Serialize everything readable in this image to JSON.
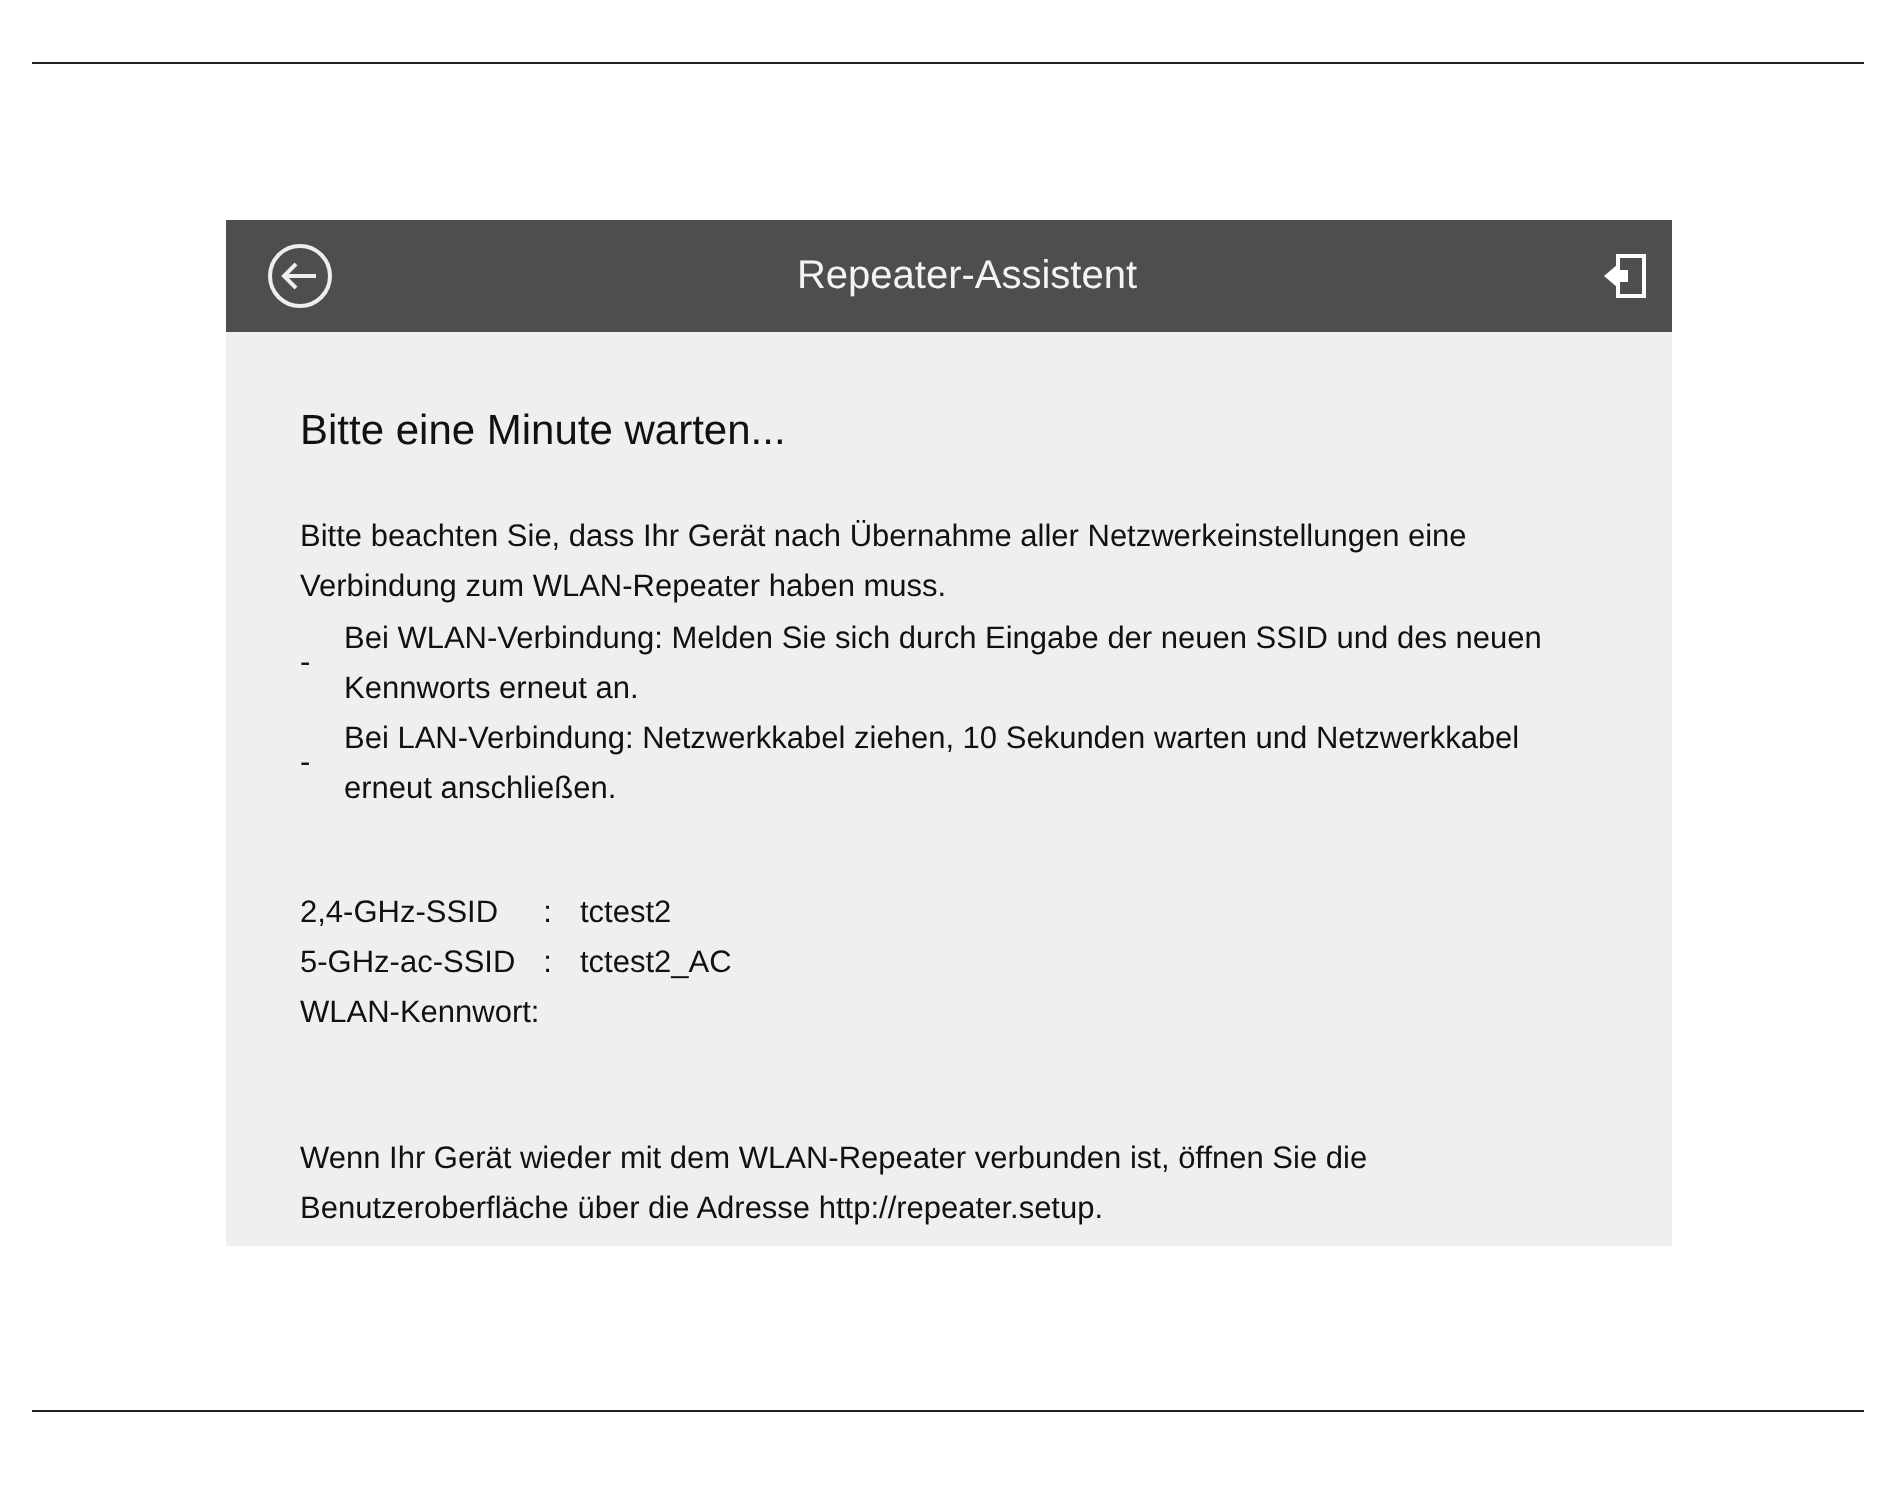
{
  "window": {
    "title": "Repeater-Assistent"
  },
  "heading": "Bitte eine Minute warten...",
  "intro": "Bitte beachten Sie, dass Ihr Gerät nach Übernahme aller Netzwerkeinstellungen eine Verbindung zum WLAN-Repeater haben muss.",
  "bullets": [
    {
      "marker": "-",
      "text": "Bei WLAN-Verbindung: Melden Sie sich durch Eingabe der neuen SSID und des neuen Kennworts erneut an."
    },
    {
      "marker": "-",
      "text": "Bei LAN-Verbindung: Netzwerkkabel ziehen, 10 Sekunden warten und Netzwerkkabel erneut anschließen."
    }
  ],
  "settings": [
    {
      "label": "2,4-GHz-SSID",
      "separator": ":",
      "value": "tctest2"
    },
    {
      "label": "5-GHz-ac-SSID",
      "separator": ":",
      "value": "tctest2_AC"
    },
    {
      "label": "WLAN-Kennwort:"
    }
  ],
  "footer": "Wenn Ihr Gerät wieder mit dem WLAN-Repeater verbunden ist, öffnen Sie die Benutzeroberfläche über die Adresse http://repeater.setup."
}
